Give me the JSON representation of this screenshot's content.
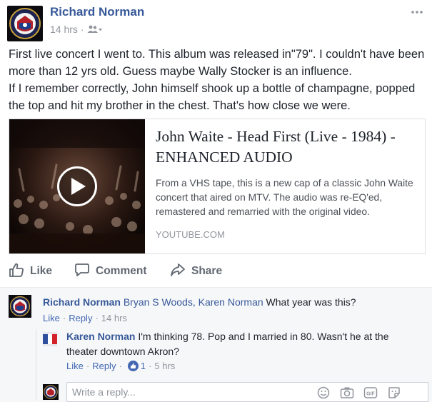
{
  "post": {
    "author": "Richard Norman",
    "time": "14 hrs",
    "separator": "·",
    "text_lines": [
      "First live concert I went to. This album was released in\"79\". I couldn't have been more than 12 yrs old. Guess maybe Wally Stocker is an influence.",
      "If I remember correctly, John himself shook up a bottle of champagne, popped the top and hit my brother in the chest. That's how close we were."
    ],
    "icons": {
      "audience": "friends-icon",
      "more": "more-options-icon"
    }
  },
  "link_card": {
    "title": "John Waite - Head First (Live - 1984) - ENHANCED AUDIO",
    "description": "From a VHS tape, this is a new cap of a classic John Waite concert that aired on MTV. The audio was re-EQ'ed, remastered and remarried with the original video.",
    "domain": "YOUTUBE.COM",
    "play_icon": "play-icon"
  },
  "actions": {
    "like": "Like",
    "comment": "Comment",
    "share": "Share"
  },
  "comments": [
    {
      "author": "Richard Norman",
      "tags": "Bryan S Woods, Karen Norman",
      "text": " What year was this?",
      "like": "Like",
      "reply": "Reply",
      "sep": "·",
      "time": "14 hrs"
    }
  ],
  "reply": {
    "author": "Karen Norman",
    "text": " I'm thinking 78. Pop and I married in 80. Wasn't he at the theater downtown Akron?",
    "like": "Like",
    "reply": "Reply",
    "sep": "·",
    "reaction_count": "1",
    "time": "5 hrs"
  },
  "reply_box": {
    "placeholder": "Write a reply...",
    "icons": [
      "emoji-icon",
      "camera-icon",
      "gif-icon",
      "sticker-icon"
    ]
  },
  "colors": {
    "link_blue": "#365899",
    "action_blue": "#4267b2",
    "meta_gray": "#90949c",
    "comment_bg": "#f6f7f9"
  }
}
